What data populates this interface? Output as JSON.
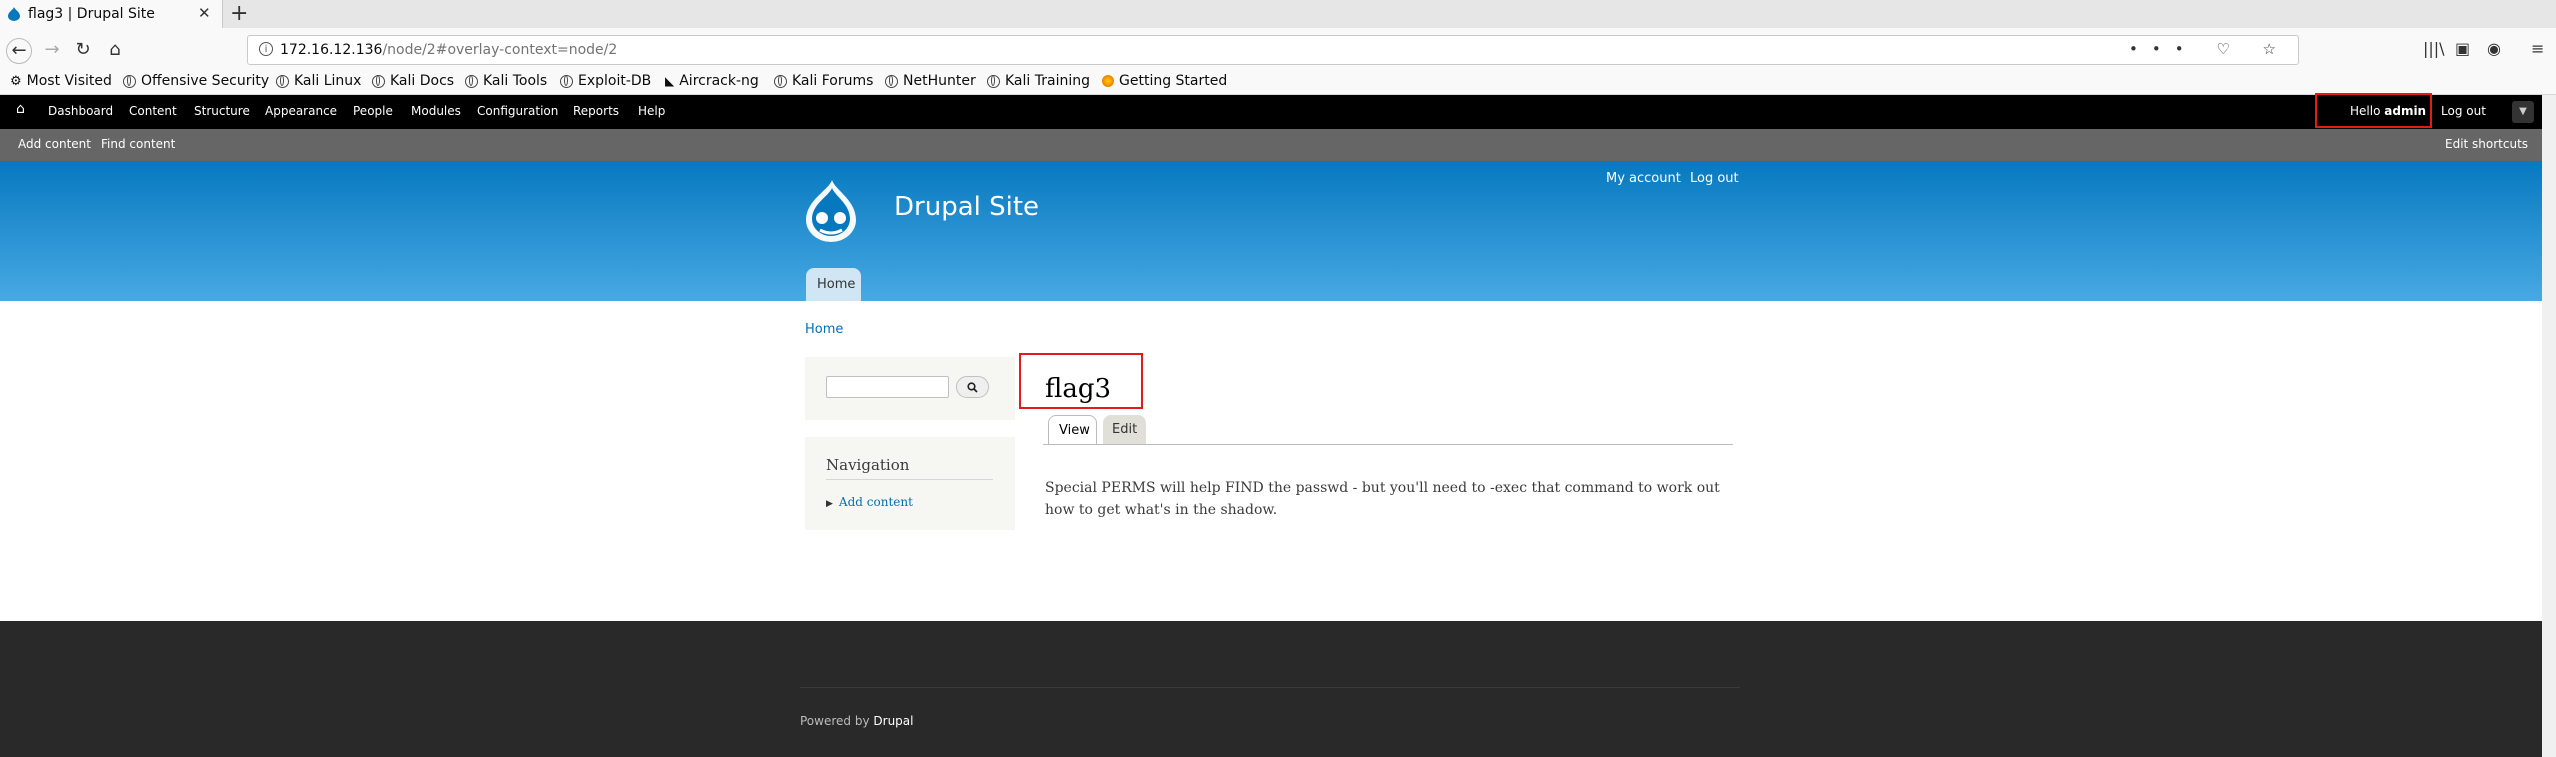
{
  "browser": {
    "tab_title": "flag3 | Drupal Site",
    "tab_close": "✕",
    "new_tab": "+",
    "url_host": "172.16.12.136",
    "url_rest": "/node/2#overlay-context=node/2",
    "url_actions": "••• ♡ ☆",
    "back": "←",
    "forward": "→",
    "reload": "↻",
    "home": "⌂",
    "bookmarks": [
      {
        "label": "Most Visited",
        "icon": "gear-icon"
      },
      {
        "label": "Offensive Security",
        "icon": "globe-icon"
      },
      {
        "label": "Kali Linux",
        "icon": "globe-icon"
      },
      {
        "label": "Kali Docs",
        "icon": "globe-icon"
      },
      {
        "label": "Kali Tools",
        "icon": "globe-icon"
      },
      {
        "label": "Exploit-DB",
        "icon": "globe-icon"
      },
      {
        "label": "Aircrack-ng",
        "icon": "aircrack-icon"
      },
      {
        "label": "Kali Forums",
        "icon": "globe-icon"
      },
      {
        "label": "NetHunter",
        "icon": "globe-icon"
      },
      {
        "label": "Kali Training",
        "icon": "globe-icon"
      },
      {
        "label": "Getting Started",
        "icon": "firefox-icon"
      }
    ]
  },
  "admin_toolbar": {
    "home_icon": "⌂",
    "menu": [
      "Dashboard",
      "Content",
      "Structure",
      "Appearance",
      "People",
      "Modules",
      "Configuration",
      "Reports",
      "Help"
    ],
    "hello": "Hello",
    "user": "admin",
    "logout": "Log out",
    "drawer": "▼",
    "shortcuts": [
      "Add content",
      "Find content"
    ],
    "edit_shortcuts": "Edit shortcuts"
  },
  "header": {
    "site_name": "Drupal Site",
    "my_account": "My account",
    "logout": "Log out",
    "home_tab": "Home"
  },
  "breadcrumb": "Home",
  "sidebar": {
    "search_button": "🔍",
    "nav_title": "Navigation",
    "nav_items": [
      "Add content"
    ]
  },
  "node": {
    "title": "flag3",
    "tabs": [
      "View",
      "Edit"
    ],
    "body": "Special PERMS will help FIND the passwd - but you'll need to -exec that command to work out how to get what's in the shadow."
  },
  "footer": {
    "powered_prefix": "Powered by",
    "powered_link": "Drupal"
  },
  "colors": {
    "toolbar": "#000000",
    "shortcuts": "#666666",
    "header_top": "#0779bf",
    "header_bottom": "#48a9e4",
    "link": "#0071b3",
    "footer": "#292929",
    "highlight": "#e31b1b"
  }
}
